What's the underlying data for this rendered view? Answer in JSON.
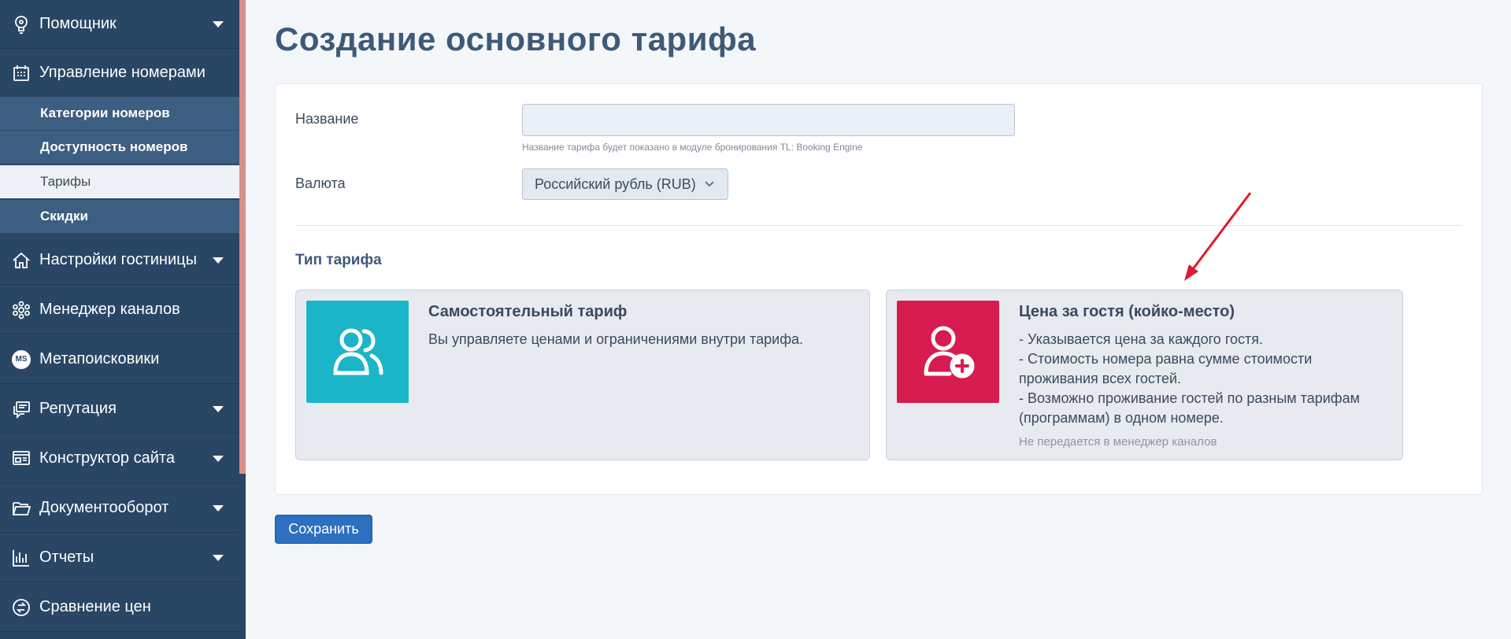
{
  "sidebar": {
    "items": [
      {
        "label": "Помощник",
        "icon": "lightbulb-icon",
        "has_caret": true
      },
      {
        "label": "Управление номерами",
        "icon": "calendar-icon",
        "has_caret": false
      },
      {
        "label": "Настройки гостиницы",
        "icon": "home-icon",
        "has_caret": true
      },
      {
        "label": "Менеджер каналов",
        "icon": "network-icon",
        "has_caret": false
      },
      {
        "label": "Метапоисковики",
        "icon": "ms-badge-icon",
        "badge": "MS",
        "has_caret": false
      },
      {
        "label": "Репутация",
        "icon": "reviews-icon",
        "has_caret": true
      },
      {
        "label": "Конструктор сайта",
        "icon": "site-builder-icon",
        "has_caret": true
      },
      {
        "label": "Документооборот",
        "icon": "folder-icon",
        "has_caret": true
      },
      {
        "label": "Отчеты",
        "icon": "bar-chart-icon",
        "has_caret": true
      },
      {
        "label": "Сравнение цен",
        "icon": "price-compare-icon",
        "has_caret": false
      }
    ],
    "sub_items": [
      {
        "label": "Категории номеров",
        "active": false
      },
      {
        "label": "Доступность номеров",
        "active": false
      },
      {
        "label": "Тарифы",
        "active": true
      },
      {
        "label": "Скидки",
        "active": false
      }
    ]
  },
  "page": {
    "title": "Создание основного тарифа"
  },
  "form": {
    "name_label": "Название",
    "name_value": "",
    "name_hint": "Название тарифа будет показано в модуле бронирования TL: Booking Engine",
    "currency_label": "Валюта",
    "currency_value": "Российский рубль (RUB)",
    "rate_type_title": "Тип тарифа"
  },
  "options": [
    {
      "title": "Самостоятельный тариф",
      "icon": "users-icon",
      "color": "#1bb5c9",
      "desc": [
        "Вы управляете ценами и ограничениями внутри тарифа."
      ],
      "note": ""
    },
    {
      "title": "Цена за гостя (койко-место)",
      "icon": "user-add-icon",
      "color": "#d81b4f",
      "desc": [
        "- Указывается цена за каждого гостя.",
        "- Стоимость номера равна сумме стоимости",
        "проживания всех гостей.",
        "- Возможно проживание гостей по разным тарифам",
        "(программам) в одном номере."
      ],
      "note": "Не передается в менеджер каналов"
    }
  ],
  "actions": {
    "save_label": "Сохранить"
  },
  "colors": {
    "sidebar_bg": "#294664",
    "accent_red": "#e01a2e",
    "primary_button": "#2d6fc1"
  }
}
